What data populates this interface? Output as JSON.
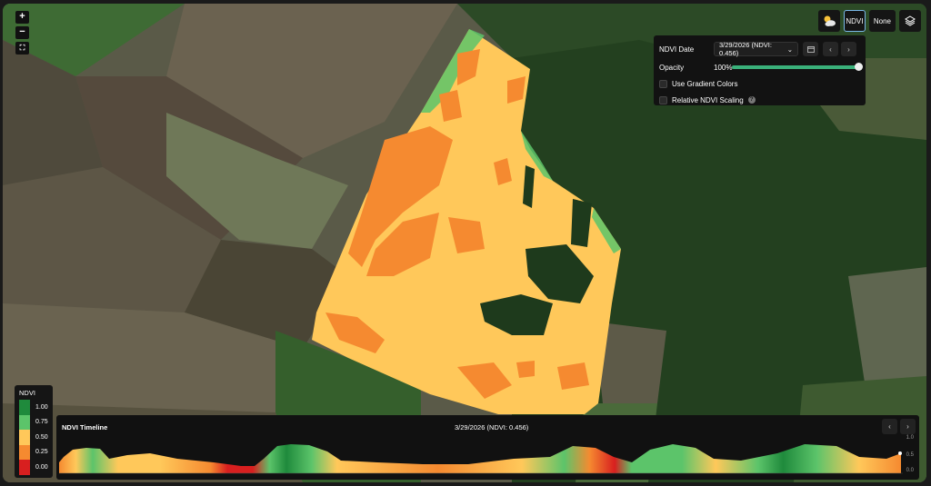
{
  "map": {
    "zoom_in": "+",
    "zoom_out": "−",
    "fullscreen": "⛶"
  },
  "toolbar": {
    "weather_icon": "partly-cloudy-icon",
    "ndvi_label": "NDVI",
    "none_label": "None",
    "layers_icon": "layers-icon"
  },
  "panel": {
    "date_label": "NDVI Date",
    "date_value": "3/29/2026 (NDVI: 0.456)",
    "opacity_label": "Opacity",
    "opacity_value": "100%",
    "opacity_fraction": 1.0,
    "gradient_label": "Use Gradient Colors",
    "gradient_checked": false,
    "relative_label": "Relative NDVI Scaling",
    "relative_checked": false,
    "help_glyph": "?"
  },
  "legend": {
    "title": "NDVI",
    "items": [
      {
        "label": "1.00",
        "color": "#1f8a3c"
      },
      {
        "label": "0.75",
        "color": "#5cc46a"
      },
      {
        "label": "0.50",
        "color": "#ffc85a"
      },
      {
        "label": "0.25",
        "color": "#f58a30"
      },
      {
        "label": "0.00",
        "color": "#d81f1f"
      }
    ]
  },
  "timeline": {
    "title": "NDVI Timeline",
    "selected": "3/29/2026 (NDVI: 0.456)",
    "y_labels": [
      "1.0",
      "0.5",
      "0.0"
    ],
    "prev_glyph": "‹",
    "next_glyph": "›"
  },
  "colors": {
    "ndvi_orange": "#f58a30",
    "ndvi_yellow": "#ffc85a",
    "ndvi_green": "#5cc46a",
    "ndvi_dark_green": "#1f8a3c",
    "ndvi_red": "#d81f1f",
    "accent": "#3ab07a"
  }
}
